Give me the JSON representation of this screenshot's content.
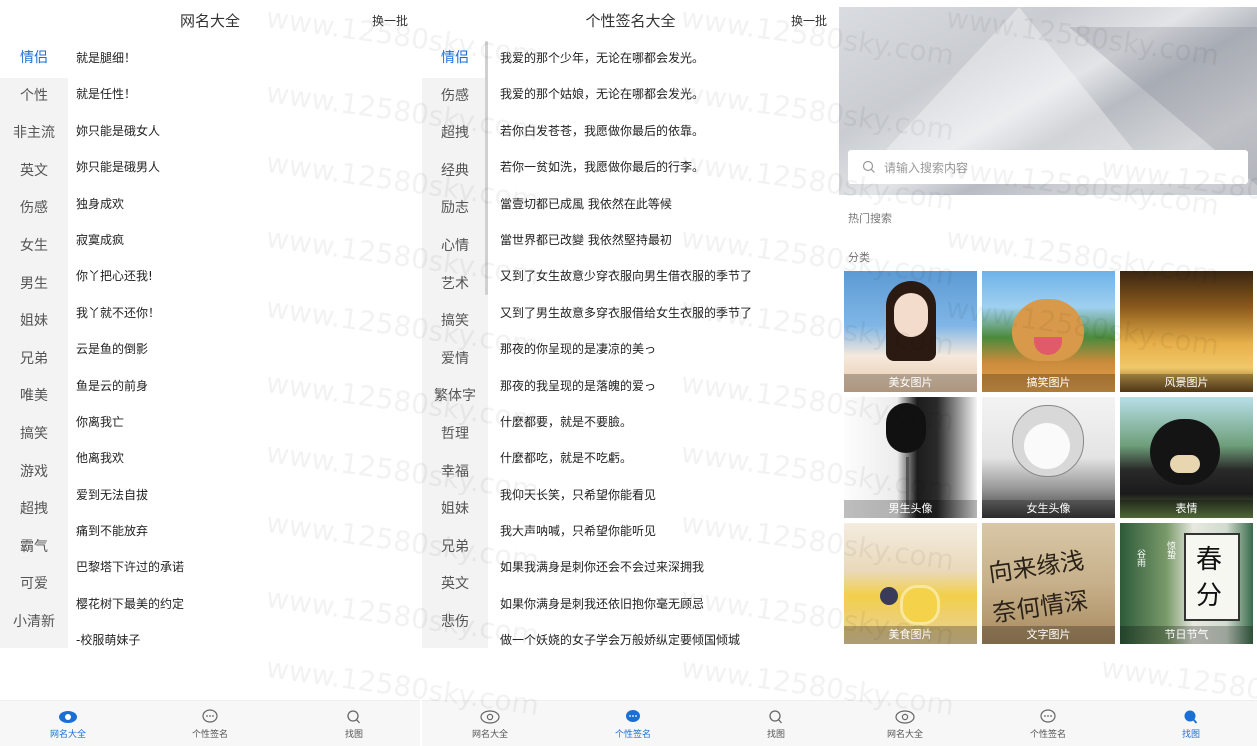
{
  "panel1": {
    "title": "网名大全",
    "swap_label": "换一批",
    "categories": [
      "情侣",
      "个性",
      "非主流",
      "英文",
      "伤感",
      "女生",
      "男生",
      "姐妹",
      "兄弟",
      "唯美",
      "搞笑",
      "游戏",
      "超拽",
      "霸气",
      "可爱",
      "小清新"
    ],
    "active_category": "情侣",
    "items": [
      "就是腿细！",
      "就是任性！",
      "妳只能是硪女人",
      "妳只能是硪男人",
      "独身成欢",
      "寂寞成疯",
      "你丫把心还我!",
      "我丫就不还你！",
      "云是鱼的倒影",
      "鱼是云的前身",
      "你离我亡",
      "他离我欢",
      "爱到无法自拔",
      "痛到不能放弃",
      "巴黎塔下许过的承诺",
      "樱花树下最美的约定",
      "-校服萌妹子"
    ]
  },
  "panel2": {
    "title": "个性签名大全",
    "swap_label": "换一批",
    "categories": [
      "情侣",
      "伤感",
      "超拽",
      "经典",
      "励志",
      "心情",
      "艺术",
      "搞笑",
      "爱情",
      "繁体字",
      "哲理",
      "幸福",
      "姐妹",
      "兄弟",
      "英文",
      "悲伤"
    ],
    "active_category": "情侣",
    "items": [
      "我爱的那个少年，无论在哪都会发光。",
      "我爱的那个姑娘，无论在哪都会发光。",
      "若你白发苍苍，我愿做你最后的依靠。",
      "若你一贫如洗，我愿做你最后的行李。",
      "當壹切都已成風 我依然在此等候",
      "當世界都已改變 我依然堅持最初",
      "又到了女生故意少穿衣服向男生借衣服的季节了",
      "又到了男生故意多穿衣服借给女生衣服的季节了",
      "那夜的你呈现的是凄凉的美っ",
      "那夜的我呈现的是落魄的爱っ",
      "什麼都要，就是不要臉。",
      "什麼都吃，就是不吃虧。",
      "我仰天长笑，只希望你能看见",
      "我大声呐喊，只希望你能听见",
      "如果我满身是刺你还会不会过来深拥我",
      "如果你满身是刺我还依旧抱你毫无顾忌",
      "做一个妖娆的女子学会万般娇纵定要倾国倾城"
    ]
  },
  "panel3": {
    "search_placeholder": "请输入搜索内容",
    "hot_label": "热门搜索",
    "category_label": "分类",
    "tiles": [
      "美女图片",
      "搞笑图片",
      "风景图片",
      "男生头像",
      "女生头像",
      "表情",
      "美食图片",
      "文字图片",
      "节日节气"
    ],
    "tile_texts": [
      "向来缘浅",
      "奈何情深",
      "春",
      "分",
      "惊蛰",
      "谷雨"
    ]
  },
  "tabbar": {
    "tab1": "网名大全",
    "tab2": "个性签名",
    "tab3": "找图"
  },
  "colors": {
    "accent": "#1a6fd6",
    "sidebar_bg": "#f3f3f3",
    "tabbar_bg": "#f7f7f7"
  },
  "watermark": "www.12580sky.com"
}
